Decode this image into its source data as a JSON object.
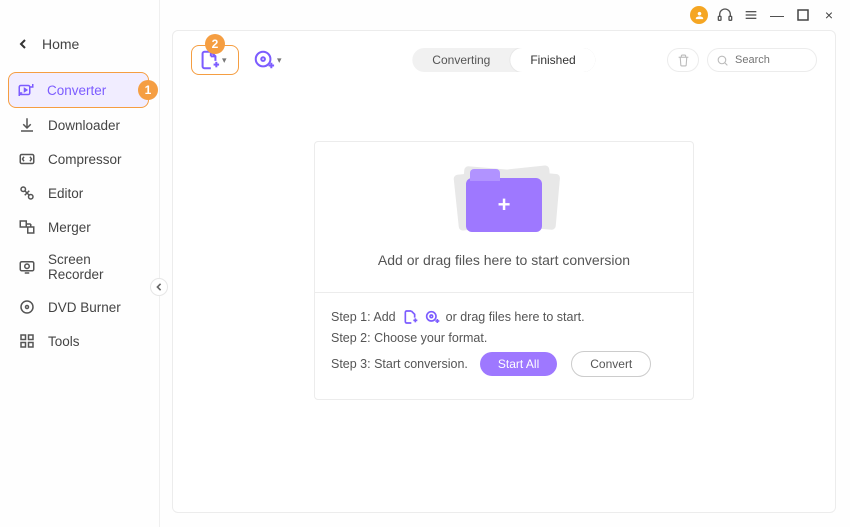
{
  "titlebar": {
    "headset_icon": "headset-icon",
    "menu_icon": "hamburger-icon",
    "minimize": "—",
    "maximize": "□",
    "close": "×"
  },
  "home": {
    "label": "Home"
  },
  "sidebar": {
    "items": [
      {
        "label": "Converter"
      },
      {
        "label": "Downloader"
      },
      {
        "label": "Compressor"
      },
      {
        "label": "Editor"
      },
      {
        "label": "Merger"
      },
      {
        "label": "Screen Recorder"
      },
      {
        "label": "DVD Burner"
      },
      {
        "label": "Tools"
      }
    ]
  },
  "annotations": {
    "one": "1",
    "two": "2"
  },
  "toolbar": {
    "tabs": {
      "converting": "Converting",
      "finished": "Finished"
    },
    "search_placeholder": "Search"
  },
  "dropzone": {
    "message": "Add or drag files here to start conversion",
    "step1_prefix": "Step 1: Add",
    "step1_suffix": "or drag files here to start.",
    "step2": "Step 2: Choose your format.",
    "step3": "Step 3: Start conversion.",
    "start_all": "Start All",
    "convert": "Convert"
  }
}
